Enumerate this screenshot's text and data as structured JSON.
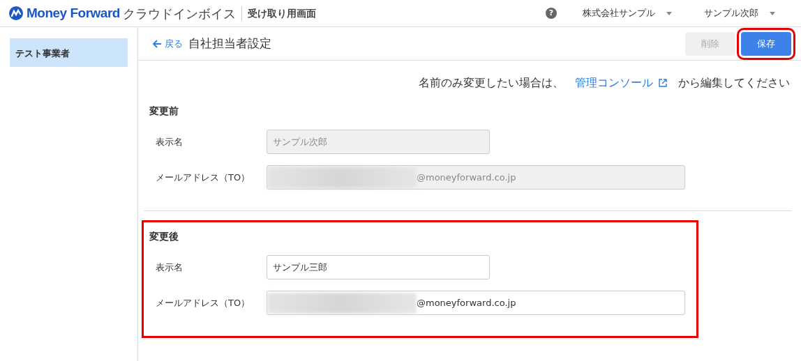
{
  "header": {
    "brand": "Money Forward",
    "product": "クラウドインボイス",
    "subtitle": "受け取り用画面",
    "company": "株式会社サンプル",
    "user": "サンプル次郎",
    "help": "?"
  },
  "sidebar": {
    "items": [
      {
        "label": "テスト事業者",
        "selected": true
      }
    ]
  },
  "page": {
    "back": "戻る",
    "title": "自社担当者設定",
    "buttons": [
      {
        "label": "削除",
        "disabled": true,
        "highlighted": false
      },
      {
        "label": "保存",
        "disabled": false,
        "highlighted": true
      }
    ]
  },
  "notice": {
    "before": "名前のみ変更したい場合は、",
    "link": "管理コンソール",
    "after": "から編集してください"
  },
  "sections": [
    {
      "title": "変更前",
      "highlighted": false,
      "disabled": true,
      "fields": [
        {
          "label": "表示名",
          "value": "サンプル次郎",
          "wide": false,
          "redacted": false
        },
        {
          "label": "メールアドレス（TO）",
          "value": "@moneyforward.co.jp",
          "wide": true,
          "redacted": true
        }
      ]
    },
    {
      "title": "変更後",
      "highlighted": true,
      "disabled": false,
      "fields": [
        {
          "label": "表示名",
          "value": "サンプル三郎",
          "wide": false,
          "redacted": false
        },
        {
          "label": "メールアドレス（TO）",
          "value": "@moneyforward.co.jp",
          "wide": true,
          "redacted": true
        }
      ]
    }
  ]
}
